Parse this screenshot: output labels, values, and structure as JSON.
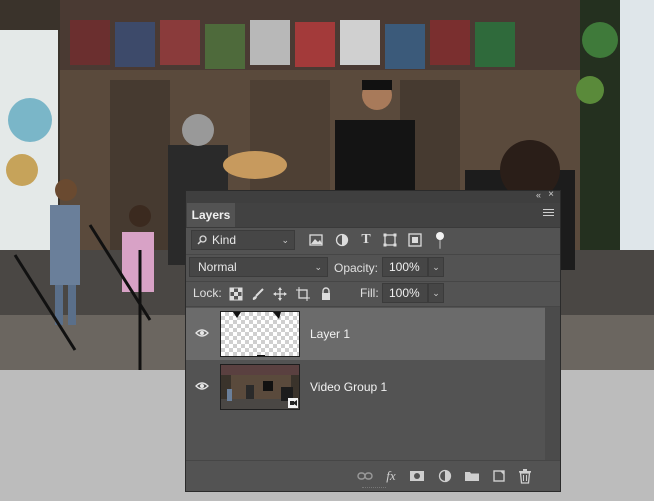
{
  "panel": {
    "tab_label": "Layers",
    "filter": {
      "label": "Kind",
      "icon": "search-icon"
    },
    "filter_icons": [
      "image-filter-icon",
      "adjustment-filter-icon",
      "type-filter-icon",
      "shape-filter-icon",
      "smart-object-filter-icon",
      "filter-toggle-icon"
    ],
    "blend_mode": "Normal",
    "opacity": {
      "label": "Opacity:",
      "value": "100%"
    },
    "lock": {
      "label": "Lock:",
      "icons": [
        "lock-transparent-pixels-icon",
        "lock-image-pixels-icon",
        "lock-position-icon",
        "lock-artboard-icon",
        "lock-all-icon"
      ]
    },
    "fill": {
      "label": "Fill:",
      "value": "100%"
    },
    "layers": [
      {
        "name": "Layer 1",
        "visible": true,
        "selected": true,
        "thumbnail": "transparent"
      },
      {
        "name": "Video Group 1",
        "visible": true,
        "selected": false,
        "thumbnail": "video"
      }
    ],
    "footer_icons": [
      "link-layers-icon",
      "fx-icon",
      "add-mask-icon",
      "adjustment-layer-icon",
      "new-group-icon",
      "new-layer-icon",
      "delete-layer-icon"
    ]
  },
  "text_glyphs": {
    "type": "T",
    "fx": "fx",
    "tab_arrows": "«",
    "close": "×",
    "chevron": "⌄"
  },
  "colors": {
    "panel_bg": "#535353",
    "selected_row": "#6b6b6b",
    "field_bg": "#464646",
    "canvas_bg": "#bcbcbc"
  }
}
